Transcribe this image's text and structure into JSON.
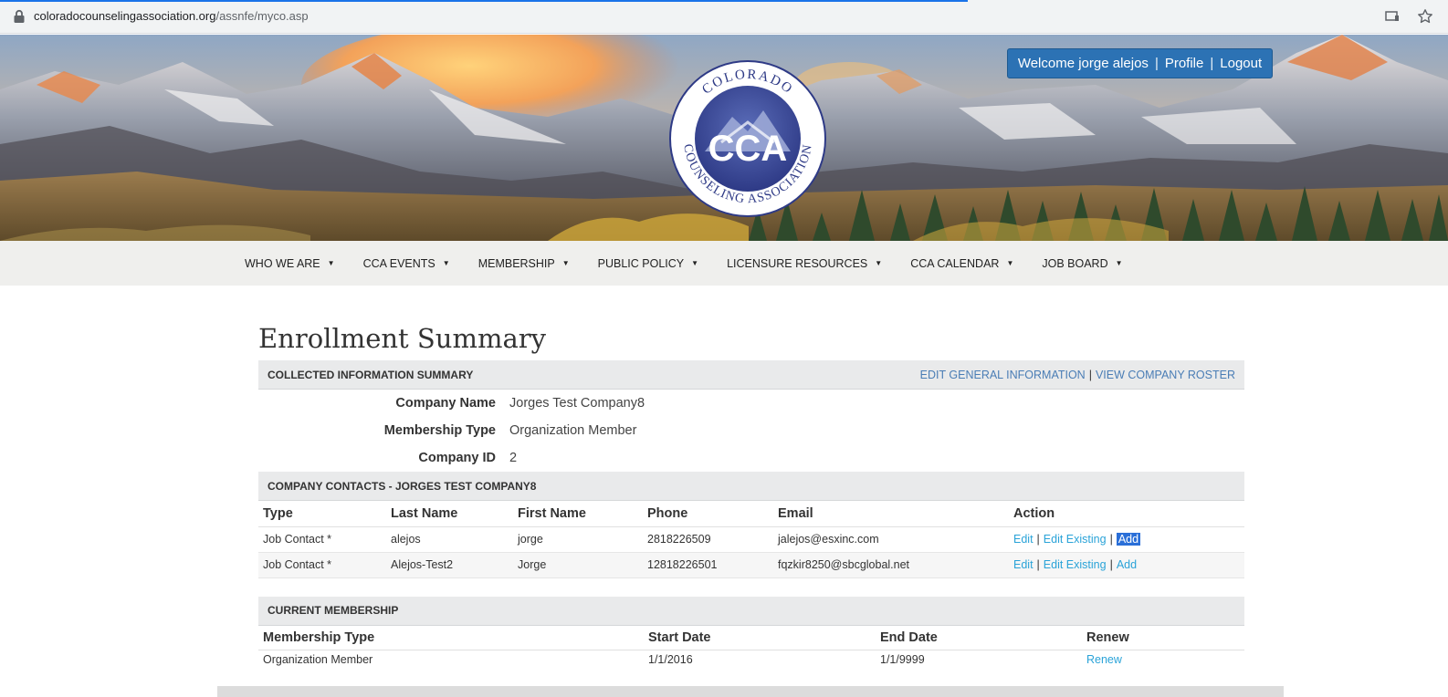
{
  "browser": {
    "url_host": "coloradocounselingassociation.org",
    "url_path": "/assnfe/myco.asp"
  },
  "header": {
    "welcome_text": "Welcome jorge alejos",
    "profile_label": "Profile",
    "logout_label": "Logout",
    "logo_text": "CCA",
    "logo_ring_text": "COLORADO COUNSELING ASSOCIATION"
  },
  "nav": {
    "items": [
      {
        "label": "WHO WE ARE"
      },
      {
        "label": "CCA EVENTS"
      },
      {
        "label": "MEMBERSHIP"
      },
      {
        "label": "PUBLIC POLICY"
      },
      {
        "label": "LICENSURE RESOURCES"
      },
      {
        "label": "CCA CALENDAR"
      },
      {
        "label": "JOB BOARD"
      }
    ]
  },
  "page": {
    "title": "Enrollment Summary"
  },
  "summary": {
    "section_title": "COLLECTED INFORMATION SUMMARY",
    "edit_general_label": "EDIT GENERAL INFORMATION",
    "view_roster_label": "VIEW COMPANY ROSTER",
    "fields": [
      {
        "label": "Company Name",
        "value": "Jorges Test Company8"
      },
      {
        "label": "Membership Type",
        "value": "Organization Member"
      },
      {
        "label": "Company ID",
        "value": "2"
      }
    ]
  },
  "contacts": {
    "section_title": "COMPANY CONTACTS - JORGES TEST COMPANY8",
    "columns": [
      "Type",
      "Last Name",
      "First Name",
      "Phone",
      "Email",
      "Action"
    ],
    "rows": [
      {
        "type": "Job Contact *",
        "last": "alejos",
        "first": "jorge",
        "phone": "2818226509",
        "email": "jalejos@esxinc.com"
      },
      {
        "type": "Job Contact *",
        "last": "Alejos-Test2",
        "first": "Jorge",
        "phone": "12818226501",
        "email": "fqzkir8250@sbcglobal.net"
      }
    ],
    "action_edit": "Edit",
    "action_edit_existing": "Edit Existing",
    "action_add": "Add"
  },
  "membership": {
    "section_title": "CURRENT MEMBERSHIP",
    "columns": [
      "Membership Type",
      "Start Date",
      "End Date",
      "Renew"
    ],
    "rows": [
      {
        "type": "Organization Member",
        "start": "1/1/2016",
        "end": "1/1/9999",
        "renew": "Renew"
      }
    ]
  },
  "colors": {
    "accent_blue": "#2c72b4",
    "link_blue": "#2aa3d8",
    "header_link_blue": "#4a7db5",
    "section_bg": "#e9eaeb"
  }
}
